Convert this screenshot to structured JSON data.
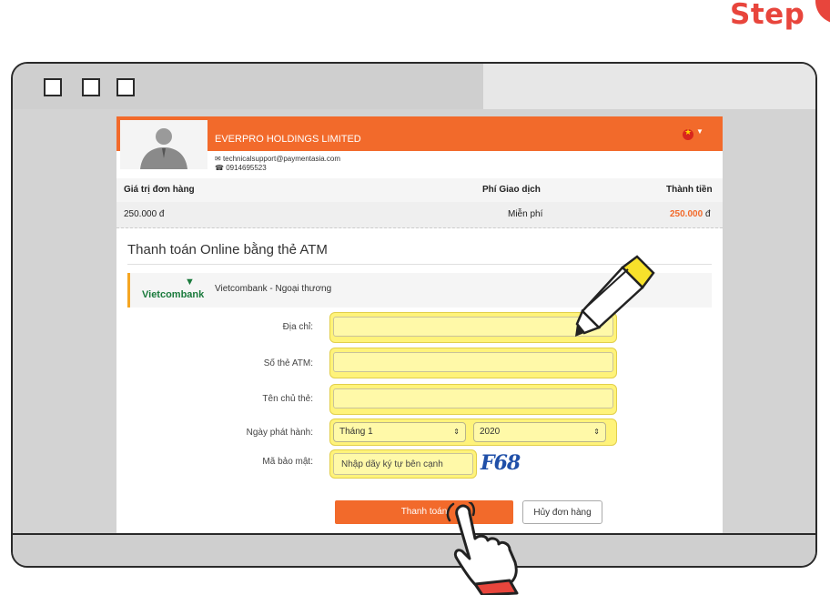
{
  "step": {
    "label": "Step"
  },
  "merchant": {
    "name": "EVERPRO HOLDINGS LIMITED",
    "email": "technicalsupport@paymentasia.com",
    "phone": "0914695523"
  },
  "order_table": {
    "headers": [
      "Giá trị đơn hàng",
      "Phí Giao dịch",
      "Thành tiền"
    ],
    "values": [
      "250.000 đ",
      "Miễn phí",
      "250.000",
      "đ"
    ]
  },
  "form": {
    "title": "Thanh toán Online bằng thẻ ATM",
    "bank_logo": "Vietcombank",
    "bank_name": "Vietcombank - Ngoại thương",
    "address_label": "Địa chỉ:",
    "card_number_label": "Số thẻ ATM:",
    "cardholder_label": "Tên chủ thẻ:",
    "issue_date_label": "Ngày phát hành:",
    "month_value": "Tháng 1",
    "year_value": "2020",
    "security_label": "Mã bảo mật:",
    "captcha_placeholder": "Nhập dãy ký tự bên cạnh",
    "captcha_code": "F68",
    "pay_button": "Thanh toán",
    "cancel_button": "Hủy đơn hàng"
  },
  "colors": {
    "accent": "#f26a2b",
    "step": "#e8453c",
    "highlight": "#fff37a",
    "bank_green": "#1a7a3c",
    "captcha_blue": "#1f4fa8"
  },
  "icons": [
    "email-icon",
    "phone-icon",
    "vietnam-flag-icon",
    "dropdown-caret-icon",
    "highlighter-pen-icon",
    "pointing-hand-icon",
    "select-arrow-icon"
  ]
}
